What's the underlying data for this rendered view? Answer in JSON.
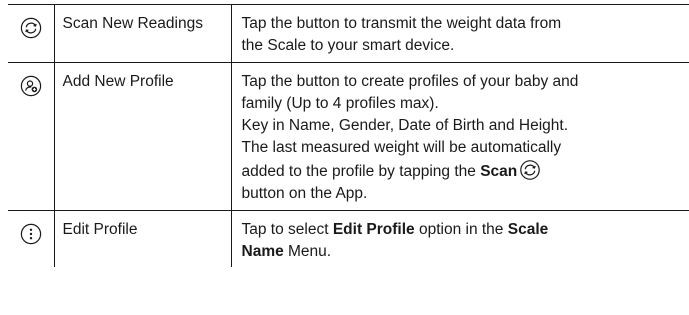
{
  "rows": [
    {
      "icon": "refresh-circle-icon",
      "name": "Scan New Readings",
      "description_lines": [
        "Tap the button to transmit the weight data from",
        "the Scale to your smart device."
      ]
    },
    {
      "icon": "add-profile-icon",
      "name": "Add New Profile",
      "description_lines": [
        "Tap the button to create profiles of your baby and",
        "family (Up to 4 profiles max).",
        "Key in Name, Gender, Date of Birth and Height.",
        "The last measured weight will be automatically",
        "added to the profile by tapping the"
      ],
      "scan_word": "Scan",
      "scan_icon": "refresh-circle-icon",
      "final_line": "button on the App."
    },
    {
      "icon": "more-vertical-circle-icon",
      "name": "Edit Profile",
      "description_parts": {
        "pre": "Tap to select ",
        "bold1": "Edit Profile",
        "mid": " option in the ",
        "bold2": "Scale",
        "line2_bold": "Name",
        "post": " Menu."
      }
    }
  ]
}
